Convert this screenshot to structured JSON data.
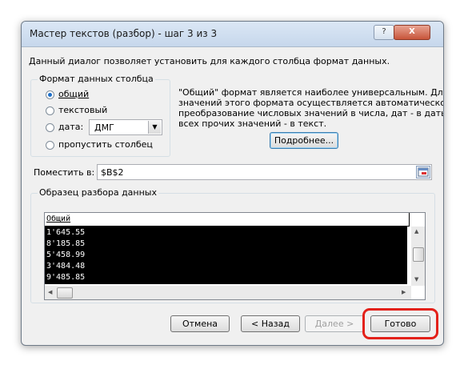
{
  "window": {
    "title": "Мастер текстов (разбор) - шаг 3 из 3",
    "help_btn": "?",
    "close_btn": "X"
  },
  "description": "Данный диалог позволяет установить для каждого столбца формат данных.",
  "format_group": {
    "label": "Формат данных столбца",
    "options": {
      "general": "общий",
      "text": "текстовый",
      "date": "дата:",
      "skip": "пропустить столбец"
    },
    "selected": "general",
    "date_format": "ДМГ"
  },
  "info_text": [
    "\"Общий\" формат является наиболее универсальным. Для",
    "значений этого формата осуществляется автоматическое",
    "преобразование числовых значений в числа, дат - в даты, а",
    "всех прочих значений - в текст."
  ],
  "more_button": "Подробнее...",
  "destination": {
    "label": "Поместить в:",
    "value": "$B$2"
  },
  "preview": {
    "label": "Образец разбора данных",
    "header": "Общий",
    "rows": [
      "1'645.55",
      "8'185.85",
      "5'458.99",
      "3'484.48",
      "9'485.85"
    ]
  },
  "buttons": {
    "cancel": "Отмена",
    "back": "< Назад",
    "next": "Далее >",
    "finish": "Готово"
  },
  "colors": {
    "highlight": "#e3211a",
    "selected_column": "#000000"
  }
}
